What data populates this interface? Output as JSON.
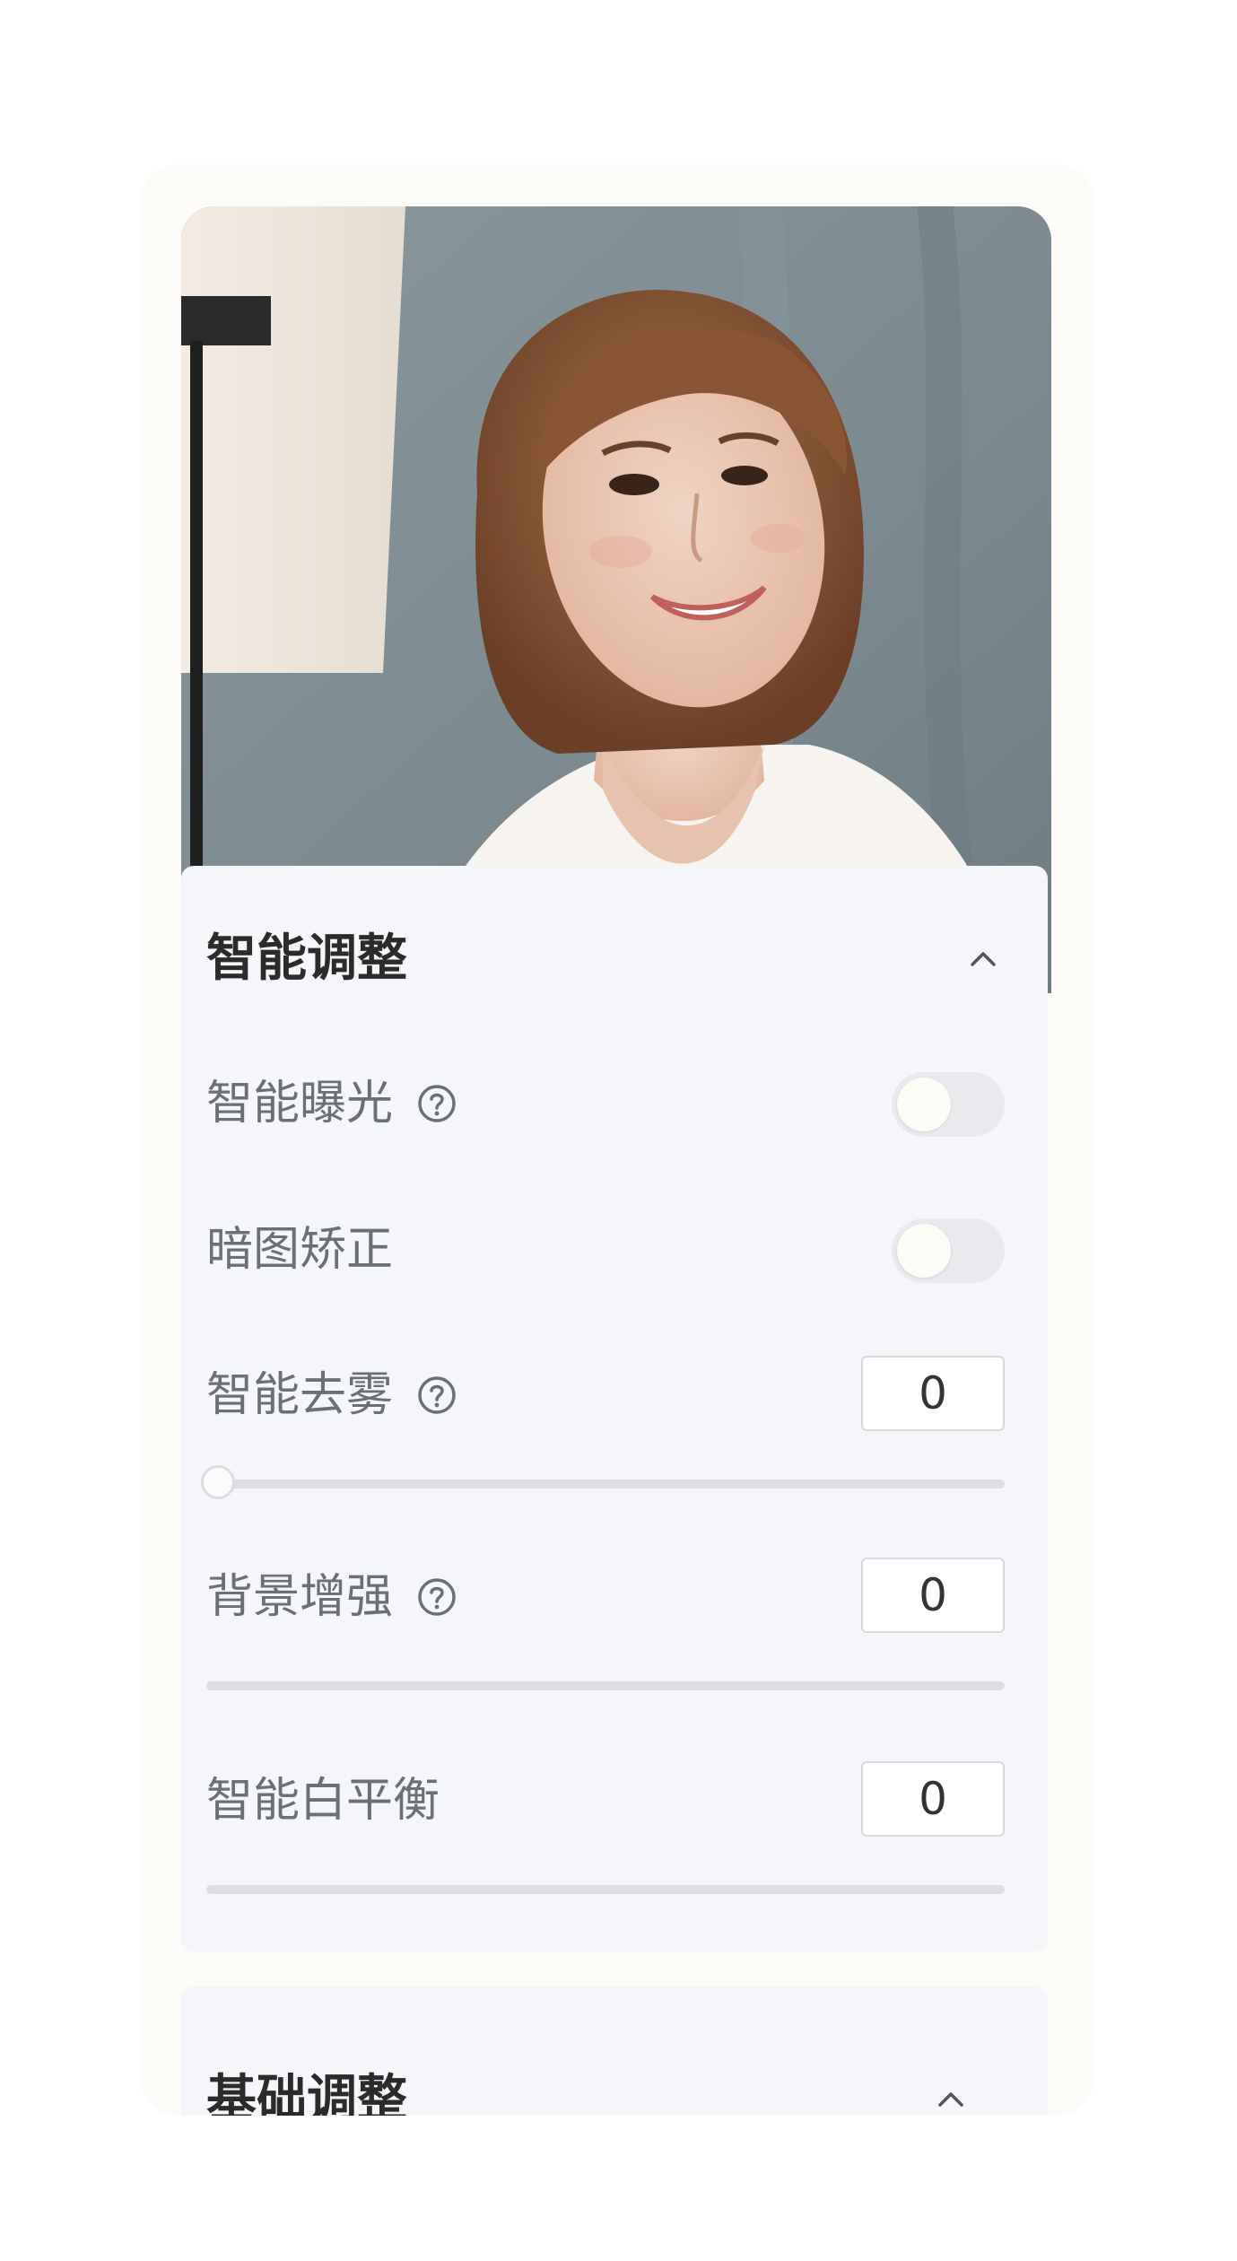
{
  "photo": {
    "description_icon": "portrait-photo"
  },
  "sections": {
    "smart": {
      "title": "智能调整",
      "toggle_icon": "chevron-up-icon",
      "rows": {
        "exposure": {
          "label": "智能曝光",
          "has_help": true,
          "control": "toggle",
          "on": false
        },
        "dark_fix": {
          "label": "暗图矫正",
          "has_help": false,
          "control": "toggle",
          "on": false
        },
        "dehaze": {
          "label": "智能去雾",
          "has_help": true,
          "control": "slider",
          "value": "0"
        },
        "background": {
          "label": "背景增强",
          "has_help": true,
          "control": "slider",
          "value": "0"
        },
        "white_balance": {
          "label": "智能白平衡",
          "has_help": false,
          "control": "slider",
          "value": "0"
        }
      }
    },
    "basic": {
      "title": "基础调整",
      "toggle_icon": "chevron-up-icon"
    }
  },
  "colors": {
    "card_bg": "#fdfbf7",
    "panel_bg": "#f5f6f9",
    "title_text": "#2b2b2b",
    "label_text": "#6b6f76",
    "toggle_off": "#e9eaed",
    "slider_track": "#dcdee4"
  }
}
